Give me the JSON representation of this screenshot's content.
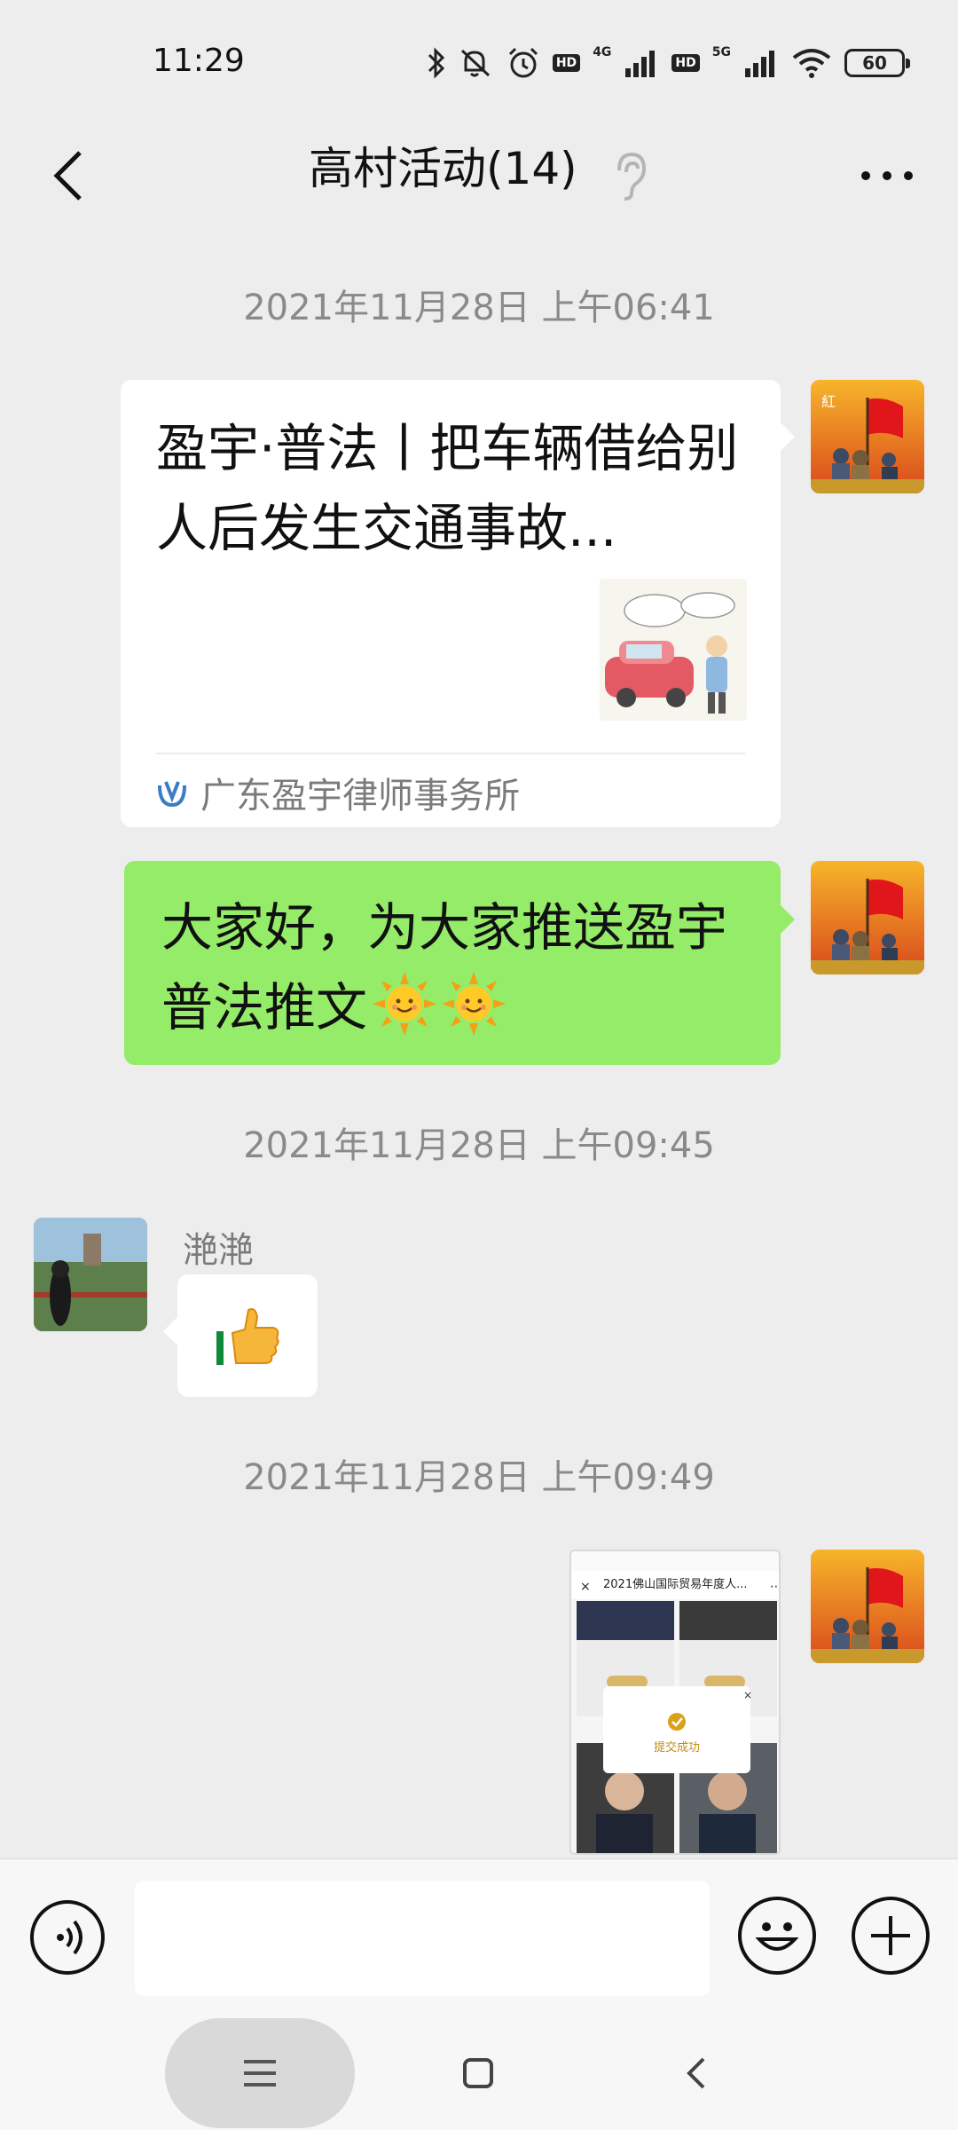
{
  "status_bar": {
    "time": "11:29",
    "hd1": "HD",
    "net1": "4G",
    "hd2": "HD",
    "net2": "5G",
    "battery": "60"
  },
  "header": {
    "title": "高村活动(14)"
  },
  "messages": [
    {
      "timestamp": "2021年11月28日 上午06:41",
      "type": "article",
      "title": "盈宇·普法丨把车辆借给别人后发生交通事故...",
      "source": "广东盈宇律师事务所"
    },
    {
      "type": "text",
      "text": "大家好，为大家推送盈宇普法推文"
    },
    {
      "timestamp": "2021年11月28日 上午09:45",
      "type": "sticker",
      "sender": "滟滟",
      "sticker_icon": "thumbs-up-icon"
    },
    {
      "timestamp": "2021年11月28日 上午09:49",
      "type": "image",
      "image_caption": "2021佛山国际贸易年度人...",
      "image_popup": "提交成功"
    }
  ],
  "colors": {
    "background": "#ededed",
    "sent_bubble": "#95ec69",
    "received_bubble": "#ffffff",
    "timestamp": "#8a8a8a"
  }
}
